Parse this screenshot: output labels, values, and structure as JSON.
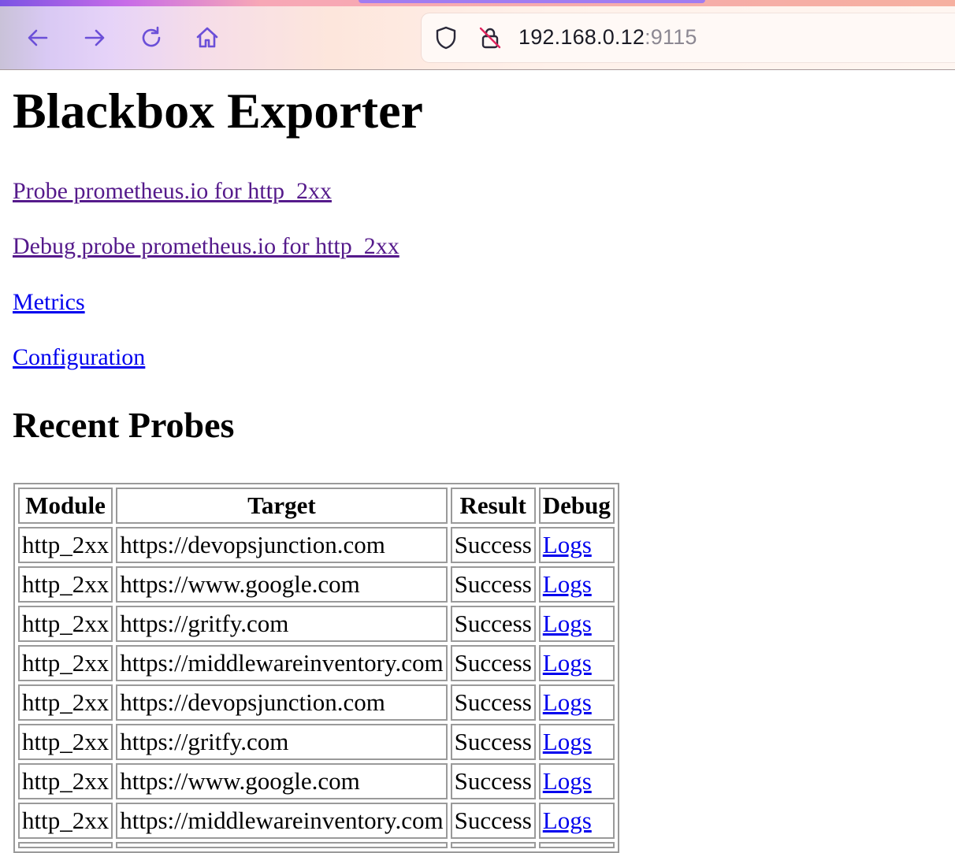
{
  "browser": {
    "url_host": "192.168.0.12",
    "url_port": ":9115",
    "icons": {
      "back": "arrow-left-icon",
      "forward": "arrow-right-icon",
      "reload": "reload-icon",
      "home": "home-icon",
      "shield": "shield-icon",
      "insecure": "insecure-lock-icon"
    },
    "accent": "#6b4fd8"
  },
  "page": {
    "title": "Blackbox Exporter",
    "links": [
      {
        "label": "Probe prometheus.io for http_2xx",
        "visited": true
      },
      {
        "label": "Debug probe prometheus.io for http_2xx",
        "visited": true
      },
      {
        "label": "Metrics",
        "visited": false
      },
      {
        "label": "Configuration",
        "visited": false
      }
    ],
    "recent_title": "Recent Probes",
    "table": {
      "headers": [
        "Module",
        "Target",
        "Result",
        "Debug"
      ],
      "rows": [
        [
          "http_2xx",
          "https://devopsjunction.com",
          "Success",
          "Logs"
        ],
        [
          "http_2xx",
          "https://www.google.com",
          "Success",
          "Logs"
        ],
        [
          "http_2xx",
          "https://gritfy.com",
          "Success",
          "Logs"
        ],
        [
          "http_2xx",
          "https://middlewareinventory.com",
          "Success",
          "Logs"
        ],
        [
          "http_2xx",
          "https://devopsjunction.com",
          "Success",
          "Logs"
        ],
        [
          "http_2xx",
          "https://gritfy.com",
          "Success",
          "Logs"
        ],
        [
          "http_2xx",
          "https://www.google.com",
          "Success",
          "Logs"
        ],
        [
          "http_2xx",
          "https://middlewareinventory.com",
          "Success",
          "Logs"
        ],
        [
          "",
          "",
          "",
          ""
        ]
      ]
    },
    "colors": {
      "link": "#0000ee",
      "visited_link": "#551a8b",
      "table_border": "#9a9a9a"
    }
  }
}
